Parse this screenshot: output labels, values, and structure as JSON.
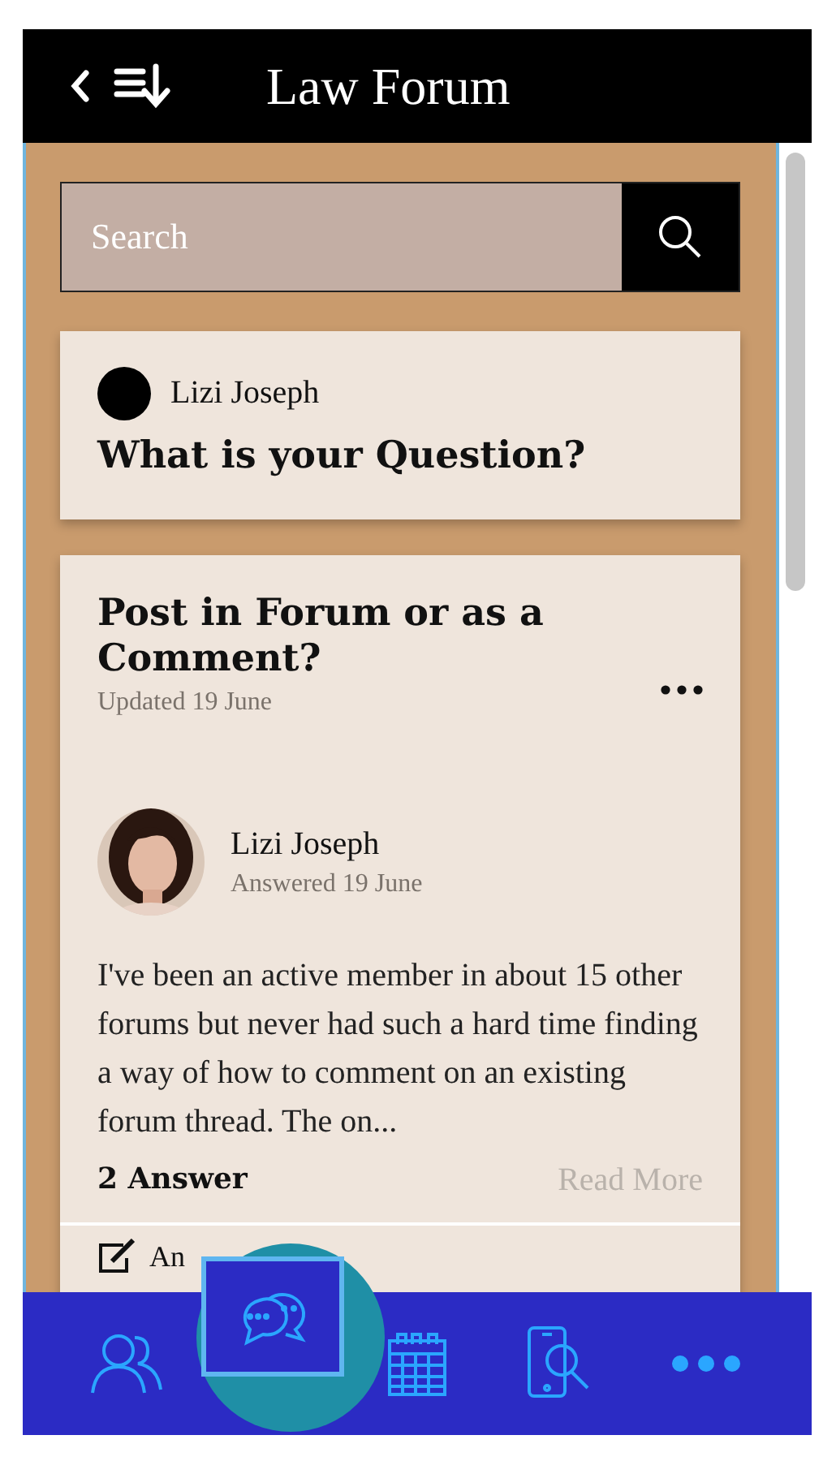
{
  "header": {
    "title": "Law Forum"
  },
  "search": {
    "placeholder": "Search"
  },
  "ask_card": {
    "user": "Lizi Joseph",
    "prompt": "What is your Question?"
  },
  "post": {
    "title": "Post in Forum or as a Comment?",
    "updated": "Updated 19 June",
    "answer": {
      "author": "Lizi Joseph",
      "date": "Answered 19 June",
      "text": "I've been an active member in about 15 other forums but never had such a hard time finding a way of how to comment on an existing forum thread. The on..."
    },
    "answer_count": "2 Answer",
    "read_more": "Read More",
    "action_label": "An"
  },
  "nav": [
    {
      "kind": "people",
      "selected": false
    },
    {
      "kind": "chat",
      "selected": true
    },
    {
      "kind": "calendar",
      "selected": false
    },
    {
      "kind": "device-search",
      "selected": false
    },
    {
      "kind": "more",
      "selected": false
    }
  ]
}
